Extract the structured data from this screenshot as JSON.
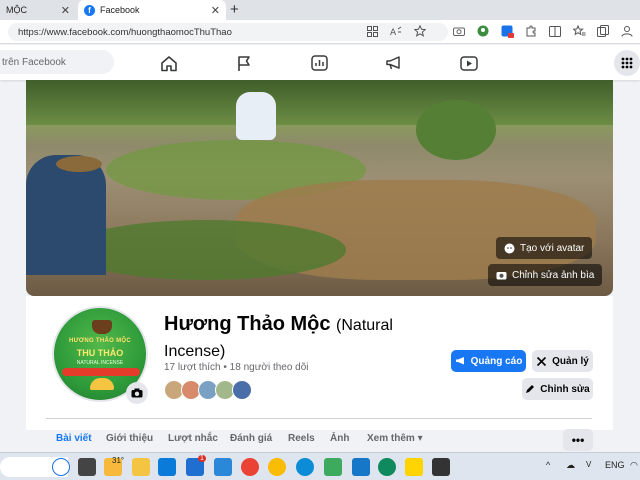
{
  "browser": {
    "tabs": [
      {
        "label": "MỘC"
      },
      {
        "label": "Facebook"
      }
    ],
    "address": "https://www.facebook.com/huongthaomocThuThao"
  },
  "fb_nav": {
    "search_placeholder": "trên Facebook"
  },
  "cover": {
    "avatar_btn": "Tạo với avatar",
    "edit_cover_btn": "Chỉnh sửa ảnh bìa"
  },
  "page": {
    "name": "Hương Thảo Mộc",
    "name_suffix": "(Natural Incense)",
    "stats": "17 lượt thích • 18 người theo dõi",
    "avatar_text": {
      "line1": "HƯƠNG THẢO MỘC",
      "line2": "THU THẢO",
      "line3": "NATURAL INCENSE"
    }
  },
  "actions": {
    "ads": "Quảng cáo",
    "manage": "Quản lý",
    "edit": "Chỉnh sửa"
  },
  "profile_tabs": [
    {
      "label": "Bài viết"
    },
    {
      "label": "Giới thiệu"
    },
    {
      "label": "Lượt nhắc"
    },
    {
      "label": "Đánh giá"
    },
    {
      "label": "Reels"
    },
    {
      "label": "Ảnh"
    },
    {
      "label": "Xem thêm"
    }
  ],
  "more_label": "•••",
  "taskbar": {
    "weather": "31°",
    "language": "ENG",
    "badge": "1"
  },
  "colors": {
    "fb_blue": "#1877f2",
    "gray_button": "#e4e6eb",
    "text_secondary": "#65676b"
  }
}
